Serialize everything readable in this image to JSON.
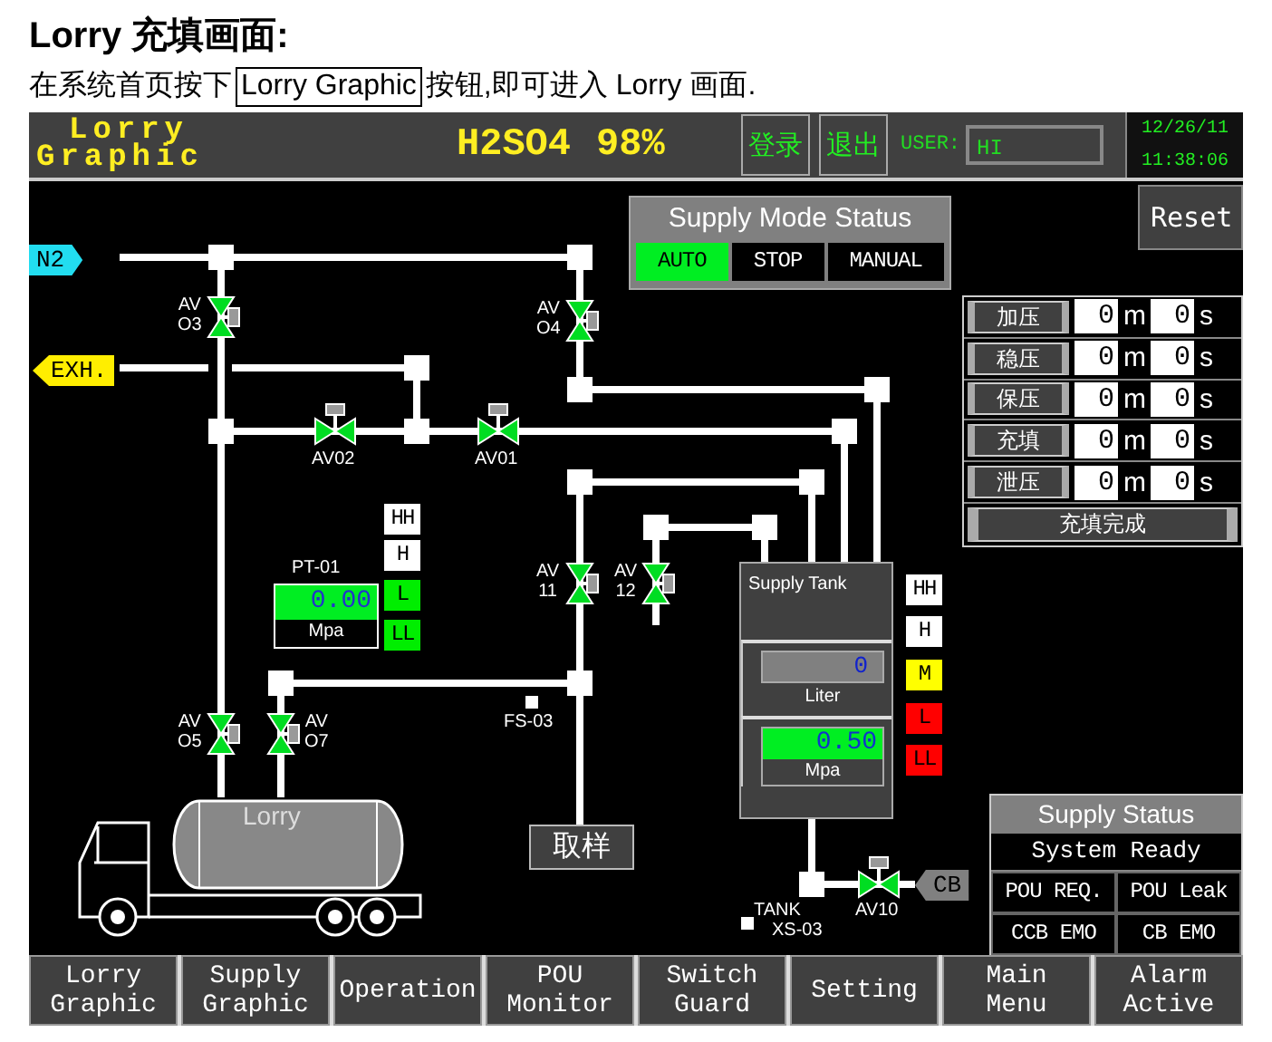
{
  "heading": "Lorry 充填画面:",
  "intro": {
    "before": "在系统首页按下",
    "button": "Lorry Graphic",
    "after": "按钮,即可进入 Lorry 画面."
  },
  "header": {
    "title_lines": [
      "Lorry",
      "Graphic"
    ],
    "chemical": "H2SO4",
    "concentration": "98%",
    "login": "登录",
    "logout": "退出",
    "user_label": "USER:",
    "user": "HI",
    "date": "12/26/11",
    "time": "11:38:06"
  },
  "ports": [
    {
      "label": "N2",
      "kind": "inlet",
      "color": "#22ddf0"
    },
    {
      "label": "EXH.",
      "kind": "outlet",
      "color": "#ffee00"
    },
    {
      "label": "CB",
      "kind": "outlet",
      "color": "#808080"
    }
  ],
  "valves": [
    {
      "line1": "AV",
      "line2": "O3",
      "open": true
    },
    {
      "line1": "AV",
      "line2": "O4",
      "open": true
    },
    {
      "line1": "AV02",
      "open": true
    },
    {
      "line1": "AV01",
      "open": true
    },
    {
      "line1": "AV",
      "line2": "11",
      "open": true
    },
    {
      "line1": "AV",
      "line2": "12",
      "open": true
    },
    {
      "line1": "AV",
      "line2": "O5",
      "open": true
    },
    {
      "line1": "AV",
      "line2": "O7",
      "open": true
    },
    {
      "line1": "AV10",
      "open": true
    }
  ],
  "supply_mode": {
    "title": "Supply Mode Status",
    "modes": [
      {
        "label": "AUTO",
        "selected": true
      },
      {
        "label": "STOP",
        "selected": false
      },
      {
        "label": "MANUAL",
        "selected": false
      }
    ]
  },
  "reset": "Reset",
  "timers": [
    {
      "step": "加压",
      "minutes": "0",
      "min_unit": "m",
      "seconds": "0",
      "sec_unit": "s"
    },
    {
      "step": "稳压",
      "minutes": "0",
      "min_unit": "m",
      "seconds": "0",
      "sec_unit": "s"
    },
    {
      "step": "保压",
      "minutes": "0",
      "min_unit": "m",
      "seconds": "0",
      "sec_unit": "s"
    },
    {
      "step": "充填",
      "minutes": "0",
      "min_unit": "m",
      "seconds": "0",
      "sec_unit": "s"
    },
    {
      "step": "泄压",
      "minutes": "0",
      "min_unit": "m",
      "seconds": "0",
      "sec_unit": "s"
    }
  ],
  "timer_done": "充填完成",
  "pt01": {
    "tag": "PT-01",
    "value": "0.00",
    "unit": "Mpa"
  },
  "pressure_alarms": [
    {
      "label": "HH",
      "color": "#ffffff"
    },
    {
      "label": "H",
      "color": "#ffffff"
    },
    {
      "label": "L",
      "color": "#00ee00"
    },
    {
      "label": "LL",
      "color": "#00ee00"
    }
  ],
  "tank": {
    "title": "Supply Tank",
    "volume": "0",
    "volume_unit": "Liter",
    "pressure": "0.50",
    "pressure_unit": "Mpa"
  },
  "tank_alarms": [
    {
      "label": "HH",
      "color": "#ffffff"
    },
    {
      "label": "H",
      "color": "#ffffff"
    },
    {
      "label": "M",
      "color": "#ffff00"
    },
    {
      "label": "L",
      "color": "#ff0000"
    },
    {
      "label": "LL",
      "color": "#ff0000"
    }
  ],
  "flow_switch": "FS-03",
  "sample_button": "取样",
  "lorry": "Lorry",
  "tank_switch": {
    "line1": "TANK",
    "line2": "XS-03"
  },
  "supply_status": {
    "title": "Supply Status",
    "state": "System Ready",
    "signals": [
      "POU REQ.",
      "POU Leak",
      "CCB EMO",
      "CB EMO"
    ]
  },
  "nav": [
    {
      "lines": [
        "Lorry",
        "Graphic"
      ]
    },
    {
      "lines": [
        "Supply",
        "Graphic"
      ]
    },
    {
      "lines": [
        "Operation"
      ]
    },
    {
      "lines": [
        "POU",
        "Monitor"
      ]
    },
    {
      "lines": [
        "Switch",
        "Guard"
      ]
    },
    {
      "lines": [
        "Setting"
      ]
    },
    {
      "lines": [
        "Main",
        "Menu"
      ]
    },
    {
      "lines": [
        "Alarm",
        "Active"
      ]
    }
  ]
}
